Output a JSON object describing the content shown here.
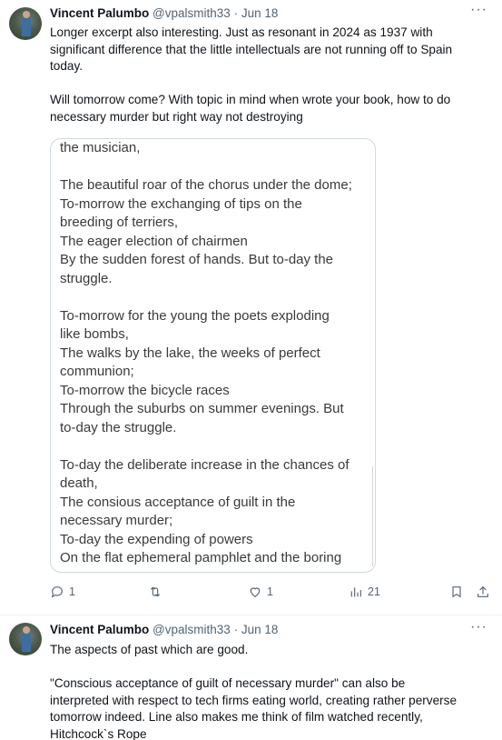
{
  "tweet1": {
    "name": "Vincent Palumbo",
    "handle": "@vpalsmith33",
    "separator": "·",
    "date": "Jun 18",
    "more": "···",
    "text": "Longer excerpt also interesting. Just as resonant in 2024 as 1937 with\nsignificant difference that the little intellectuals are not running off to Spain\ntoday.\n\nWill tomorrow come? With topic in mind when wrote your book, how to do\nnecessary murder but right way not destroying",
    "poem": "the musician,\n\nThe beautiful roar of the chorus under the dome;\nTo-morrow the exchanging of tips on the\nbreeding of terriers,\nThe eager election of chairmen\nBy the sudden forest of hands. But to-day the\nstruggle.\n\nTo-morrow for the young the poets exploding\nlike bombs,\nThe walks by the lake, the weeks of perfect\ncommunion;\nTo-morrow the bicycle races\nThrough the suburbs on summer evenings. But\nto-day the struggle.\n\nTo-day the deliberate increase in the chances of\ndeath,\nThe consious acceptance of guilt in the\nnecessary murder;\nTo-day the expending of powers\nOn the flat ephemeral pamphlet and the boring",
    "actions": {
      "reply_count": "1",
      "retweet_count": "",
      "like_count": "1",
      "views_count": "21"
    }
  },
  "tweet2": {
    "name": "Vincent Palumbo",
    "handle": "@vpalsmith33",
    "separator": "·",
    "date": "Jun 18",
    "more": "···",
    "text": "The aspects of past which are good.\n\n\"Conscious acceptance of guilt of necessary murder\" can also be\ninterpreted with respect to tech firms eating world, creating rather perverse\ntomorrow indeed. Line also makes me think of film watched recently,\nHitchcock`s Rope"
  },
  "icons": [
    "reply-icon",
    "retweet-icon",
    "like-icon",
    "views-icon",
    "bookmark-icon",
    "share-icon",
    "more-icon"
  ],
  "colors": {
    "text": "#0f1419",
    "secondary": "#536471",
    "border": "#cfd9de"
  }
}
